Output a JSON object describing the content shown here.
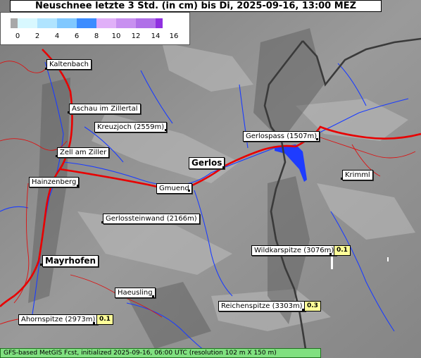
{
  "title": "Neuschnee letzte 3 Std. (in cm) bis Di, 2025-09-16, 13:00 MEZ",
  "legend": {
    "ticks": [
      "0",
      "2",
      "4",
      "6",
      "8",
      "10",
      "12",
      "14",
      "16"
    ],
    "colors": [
      "#a8a8a8",
      "#d8f8ff",
      "#b0e4ff",
      "#80c8ff",
      "#3c8cff",
      "#e0b0f8",
      "#c890f0",
      "#b070e8",
      "#9030e0"
    ]
  },
  "places": [
    {
      "name": "Kaltenbach"
    },
    {
      "name": "Aschau im Zillertal"
    },
    {
      "name": "Kreuzjoch (2559m)"
    },
    {
      "name": "Zell am Ziller"
    },
    {
      "name": "Gerlospass (1507m)"
    },
    {
      "name": "Gerlos"
    },
    {
      "name": "Hainzenberg"
    },
    {
      "name": "Gmuend"
    },
    {
      "name": "Krimml"
    },
    {
      "name": "Gerlossteinwand (2166m)"
    },
    {
      "name": "Wildkarspitze (3076m)",
      "value": "0.1"
    },
    {
      "name": "Mayrhofen"
    },
    {
      "name": "Haeusling"
    },
    {
      "name": "Reichenspitze (3303m)",
      "value": "0.3"
    },
    {
      "name": "Ahornspitze (2973m)",
      "value": "0.1"
    }
  ],
  "footer": "GFS-based MetGIS Fcst, initialized 2025-09-16, 06:00 UTC  (resolution 102 m X 150 m)"
}
